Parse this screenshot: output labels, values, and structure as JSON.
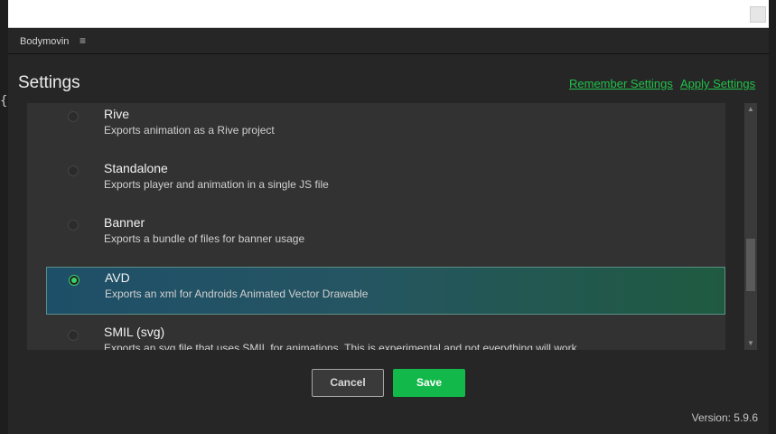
{
  "panel": {
    "name": "Bodymovin",
    "menu_glyph": "≡"
  },
  "side_glyph": "{",
  "page": {
    "title": "Settings",
    "remember_label": "Remember Settings",
    "apply_label": "Apply Settings"
  },
  "options": [
    {
      "title": "Rive",
      "desc": "Exports animation as a Rive project",
      "selected": false
    },
    {
      "title": "Standalone",
      "desc": "Exports player and animation in a single JS file",
      "selected": false
    },
    {
      "title": "Banner",
      "desc": "Exports a bundle of files for banner usage",
      "selected": false
    },
    {
      "title": "AVD",
      "desc": "Exports an xml for Androids Animated Vector Drawable",
      "selected": true
    },
    {
      "title": "SMIL (svg)",
      "desc": "Exports an svg file that uses SMIL for animations. This is experimental and not everything will work",
      "selected": false
    }
  ],
  "scrollbar": {
    "up_glyph": "▲",
    "down_glyph": "▼"
  },
  "buttons": {
    "cancel": "Cancel",
    "save": "Save"
  },
  "version": "Version: 5.9.6",
  "colors": {
    "accent": "#13b84a",
    "link": "#20c04a",
    "selected_radio": "#3bd06a"
  }
}
